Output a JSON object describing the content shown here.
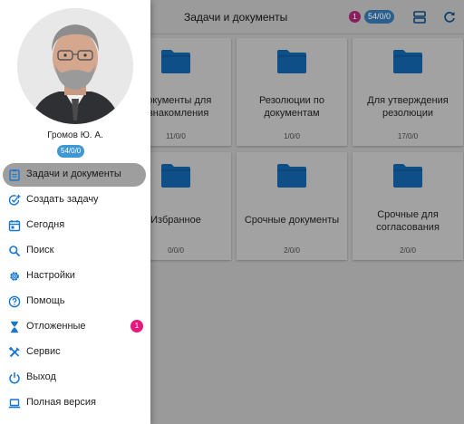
{
  "header": {
    "title": "Задачи и документы",
    "notification_count": "1",
    "counter_badge": "54/0/0"
  },
  "cards": [
    {
      "label": "Документы для ознакомления",
      "count": "11/0/0"
    },
    {
      "label": "Резолюции по документам",
      "count": "1/0/0"
    },
    {
      "label": "Для утверждения резолюции",
      "count": "17/0/0"
    },
    {
      "label": "Избранное",
      "count": "0/0/0"
    },
    {
      "label": "Срочные документы",
      "count": "2/0/0"
    },
    {
      "label": "Срочные для согласования",
      "count": "2/0/0"
    }
  ],
  "drawer": {
    "user_name": "Громов Ю. А.",
    "user_counter": "54/0/0",
    "items": [
      {
        "label": "Задачи и документы",
        "icon": "clipboard-icon",
        "active": true
      },
      {
        "label": "Создать задачу",
        "icon": "add-task-icon"
      },
      {
        "label": "Сегодня",
        "icon": "calendar-today-icon"
      },
      {
        "label": "Поиск",
        "icon": "search-icon"
      },
      {
        "label": "Настройки",
        "icon": "gear-icon"
      },
      {
        "label": "Помощь",
        "icon": "help-icon"
      },
      {
        "label": "Отложенные",
        "icon": "hourglass-icon",
        "badge": "1"
      },
      {
        "label": "Сервис",
        "icon": "tools-icon"
      },
      {
        "label": "Выход",
        "icon": "power-icon"
      },
      {
        "label": "Полная версия",
        "icon": "laptop-icon"
      }
    ]
  },
  "colors": {
    "accent": "#1976d2",
    "badge_pink": "#e6197e",
    "counter_blue": "#3f97d6",
    "overlay": "#9a9a9a"
  }
}
